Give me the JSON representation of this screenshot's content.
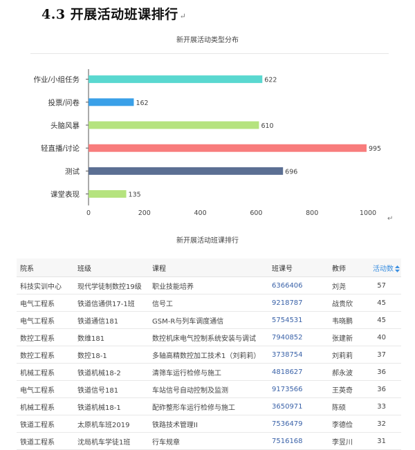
{
  "heading": {
    "text": "4.3 开展活动班课排行",
    "mark": "↵"
  },
  "chart_data": {
    "type": "bar",
    "orientation": "horizontal",
    "title": "新开展活动类型分布",
    "categories": [
      "作业/小组任务",
      "投票/问卷",
      "头脑风暴",
      "轻直播/讨论",
      "测试",
      "课堂表现"
    ],
    "values": [
      622,
      162,
      610,
      995,
      696,
      135
    ],
    "bar_colors": [
      "#5ad8d0",
      "#3aa0e8",
      "#b5e37e",
      "#f87c7c",
      "#5b6f93",
      "#b5e37e"
    ],
    "xlim": [
      0,
      1000
    ],
    "xticks": [
      0,
      200,
      400,
      600,
      800,
      1000
    ],
    "grid": false,
    "legend": false
  },
  "chart_return_mark": "↵",
  "table": {
    "title": "新开展活动班课排行",
    "headers": [
      "院系",
      "班级",
      "课程",
      "班课号",
      "教师",
      "活动数"
    ],
    "sort_icon": "sort-icon",
    "rows": [
      [
        "科技实训中心",
        "现代学徒制数控19级",
        "职业技能培养",
        "6366406",
        "刘尧",
        "57"
      ],
      [
        "电气工程系",
        "铁道信通供17-1班",
        "信号工",
        "9218787",
        "战贵欣",
        "45"
      ],
      [
        "电气工程系",
        "铁道通信181",
        "GSM-R与列车调度通信",
        "5754531",
        "韦晓鹏",
        "45"
      ],
      [
        "数控工程系",
        "数维181",
        "数控机床电气控制系统安装与调试",
        "7940852",
        "张建新",
        "40"
      ],
      [
        "数控工程系",
        "数控18-1",
        "多轴高精数控加工技术1（刘莉莉）",
        "3738754",
        "刘莉莉",
        "37"
      ],
      [
        "机械工程系",
        "铁道机械18-2",
        "清筛车运行检修与施工",
        "4818627",
        "郝永波",
        "36"
      ],
      [
        "电气工程系",
        "铁道信号181",
        "车站信号自动控制及监测",
        "9173566",
        "王英奇",
        "36"
      ],
      [
        "机械工程系",
        "铁道机械18-1",
        "配砟整形车运行检修与施工",
        "3650971",
        "陈硕",
        "33"
      ],
      [
        "铁道工程系",
        "太原机车班2019",
        "铁路技术管理II",
        "7536479",
        "李德俭",
        "32"
      ],
      [
        "铁道工程系",
        "沈局机车学徒1班",
        "行车规章",
        "7516168",
        "李昱川",
        "31"
      ]
    ]
  }
}
